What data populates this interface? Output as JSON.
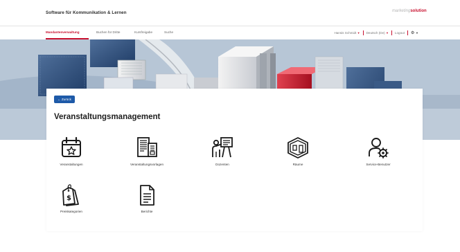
{
  "header": {
    "app_title": "Software für Kommunikation & Lernen",
    "logo_part1": "marketing",
    "logo_part2": "solution"
  },
  "nav": {
    "tabs": [
      {
        "label": "Mandantenverwaltung",
        "active": true
      },
      {
        "label": "Buchen für Dritte",
        "active": false
      },
      {
        "label": "Kursfreigabe",
        "active": false
      },
      {
        "label": "Suche",
        "active": false
      }
    ],
    "user_label": "Hansis Schmidt",
    "language_label": "Deutsch (De)",
    "logout_label": "Logout"
  },
  "page": {
    "back_label": "← Zurück",
    "title": "Veranstaltungsmanagement"
  },
  "tiles": [
    {
      "label": "Veranstaltungen",
      "icon": "calendar-star-icon"
    },
    {
      "label": "Veranstaltungsvorlagen",
      "icon": "templates-icon"
    },
    {
      "label": "Dozenten",
      "icon": "lecturer-icon"
    },
    {
      "label": "Räume",
      "icon": "rooms-icon"
    },
    {
      "label": "Service-Benutzer",
      "icon": "service-user-icon"
    },
    {
      "label": "Preiskategorien",
      "icon": "price-tags-icon"
    },
    {
      "label": "Berichte",
      "icon": "report-icon"
    }
  ],
  "colors": {
    "accent": "#c8102e",
    "button": "#1e5aa8",
    "background": "#f2f2f2"
  }
}
